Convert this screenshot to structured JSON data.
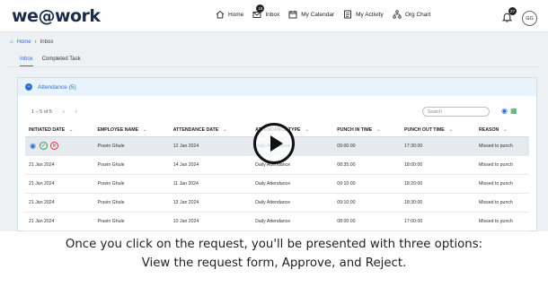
{
  "app": {
    "logo": "we@work"
  },
  "nav": [
    {
      "label": "Home",
      "icon": "home-icon"
    },
    {
      "label": "Inbox",
      "icon": "mail-icon",
      "badge": "18"
    },
    {
      "label": "My Calendar",
      "icon": "calendar-icon"
    },
    {
      "label": "My Activity",
      "icon": "activity-icon"
    },
    {
      "label": "Org Chart",
      "icon": "org-chart-icon"
    }
  ],
  "notifications": {
    "count": "27"
  },
  "user": {
    "initials": "GG"
  },
  "breadcrumb": {
    "home": "Home",
    "current": "Inbox"
  },
  "tabs": [
    {
      "label": "Inbox"
    },
    {
      "label": "Completed Task"
    }
  ],
  "panel": {
    "title": "Attendance (5)",
    "toggle": "−"
  },
  "toolbar": {
    "pager": "1 – 5 of 5",
    "prev": "‹",
    "next": "›",
    "search_placeholder": "Search"
  },
  "table": {
    "columns": [
      "INITIATED DATE",
      "EMPLOYEE NAME",
      "ATTENDANCE DATE",
      "ATTENDANCE TYPE",
      "PUNCH IN TIME",
      "PUNCH OUT TIME",
      "REASON"
    ],
    "rows": [
      {
        "initiated": "",
        "employee": "Pravin Ghule",
        "date": "12 Jan 2024",
        "type": "Daily Attendance",
        "in": "09:00:00",
        "out": "17:30:00",
        "reason": "Missed to punch"
      },
      {
        "initiated": "21 Jan 2024",
        "employee": "Pravin Ghule",
        "date": "14 Jan 2024",
        "type": "Daily Attendance",
        "in": "08:35:00",
        "out": "18:00:00",
        "reason": "Missed to punch"
      },
      {
        "initiated": "21 Jan 2024",
        "employee": "Pravin Ghule",
        "date": "11 Jan 2024",
        "type": "Daily Attendance",
        "in": "09:10:00",
        "out": "18:20:00",
        "reason": "Missed to punch"
      },
      {
        "initiated": "21 Jan 2024",
        "employee": "Pravin Ghule",
        "date": "13 Jan 2024",
        "type": "Daily Attendance",
        "in": "09:10:00",
        "out": "18:30:00",
        "reason": "Missed to punch"
      },
      {
        "initiated": "21 Jan 2024",
        "employee": "Pravin Ghule",
        "date": "10 Jan 2024",
        "type": "Daily Attendance",
        "in": "08:00:00",
        "out": "17:00:00",
        "reason": "Missed to punch"
      }
    ]
  },
  "caption": {
    "line1": "Once you click on the request, you'll be presented with three options:",
    "line2": "View the request form, Approve, and Reject."
  },
  "colors": {
    "accent": "#2f6fd6",
    "approve": "#2e9d55",
    "reject": "#d9363e"
  }
}
